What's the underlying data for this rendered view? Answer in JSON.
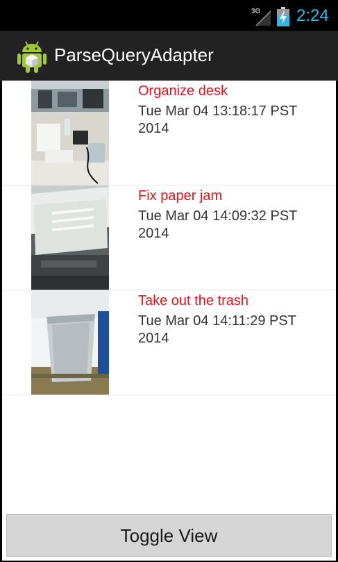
{
  "status_bar": {
    "network": "3G",
    "time": "2:24",
    "accent": "#33b5e5"
  },
  "action_bar": {
    "icon": "android-icon",
    "title": "ParseQueryAdapter"
  },
  "list": {
    "title_color": "#e3141e",
    "items": [
      {
        "title": "Organize desk",
        "date": "Tue Mar 04 13:18:17 PST 2014",
        "image": "office-desk-photo"
      },
      {
        "title": "Fix paper jam",
        "date": "Tue Mar 04 14:09:32 PST 2014",
        "image": "printer-photo"
      },
      {
        "title": "Take out the trash",
        "date": "Tue Mar 04 14:11:29 PST 2014",
        "image": "trash-can-photo"
      }
    ]
  },
  "toggle_button": {
    "label": "Toggle View"
  }
}
